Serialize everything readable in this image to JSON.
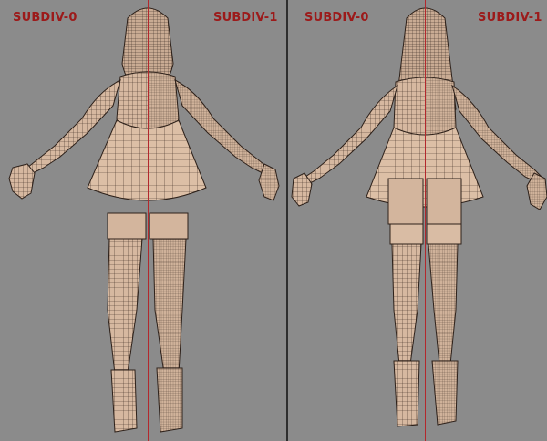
{
  "labels": {
    "left_subdiv0": "SUBDIV-0",
    "left_subdiv1": "SUBDIV-1",
    "right_subdiv0": "SUBDIV-0",
    "right_subdiv1": "SUBDIV-1"
  },
  "colors": {
    "background": "#8b8b8b",
    "separator": "#2e2e2e",
    "label": "#9c1a1a",
    "split_line": "#b3282d",
    "mesh_fill": "#d7b9a1",
    "mesh_line": "#3a2a22"
  },
  "views": [
    "front",
    "back"
  ]
}
